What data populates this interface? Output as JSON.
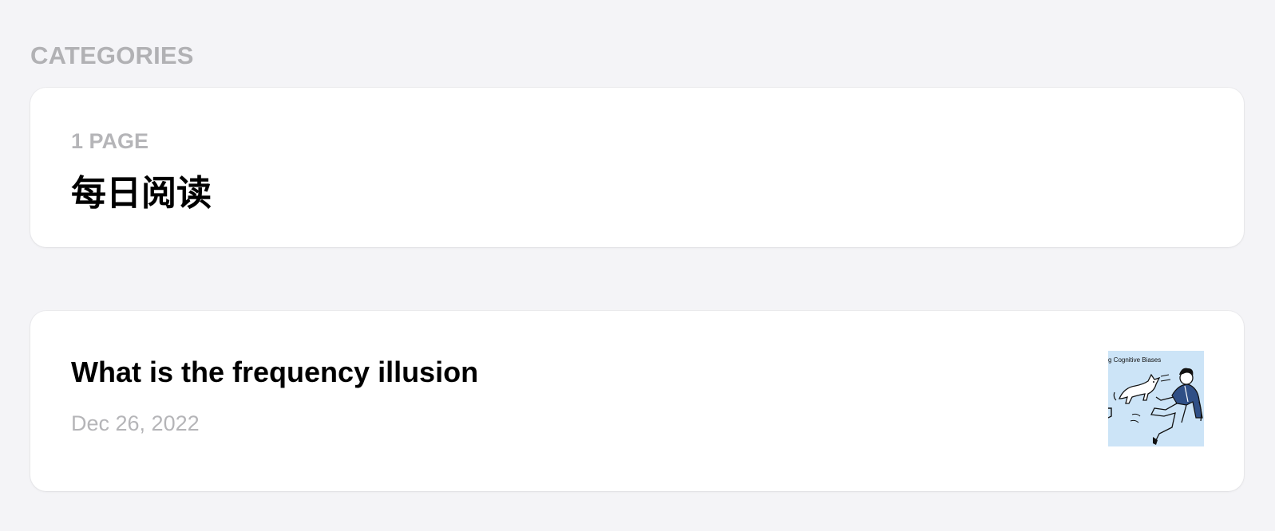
{
  "categories_section": {
    "heading": "CATEGORIES"
  },
  "category_card": {
    "page_count": "1 PAGE",
    "title": "每日阅读"
  },
  "post_card": {
    "title": "What is the frequency illusion",
    "date": "Dec 26, 2022",
    "thumbnail": {
      "caption": "g Cognitive Biases",
      "background": "#cce4f7",
      "icon": "illustration-person-running-from-dog"
    }
  },
  "colors": {
    "page_background": "#f4f4f7",
    "card_background": "#ffffff",
    "muted_text": "#b5b5b8",
    "primary_text": "#000000",
    "illustration_accent": "#2f4f86"
  }
}
